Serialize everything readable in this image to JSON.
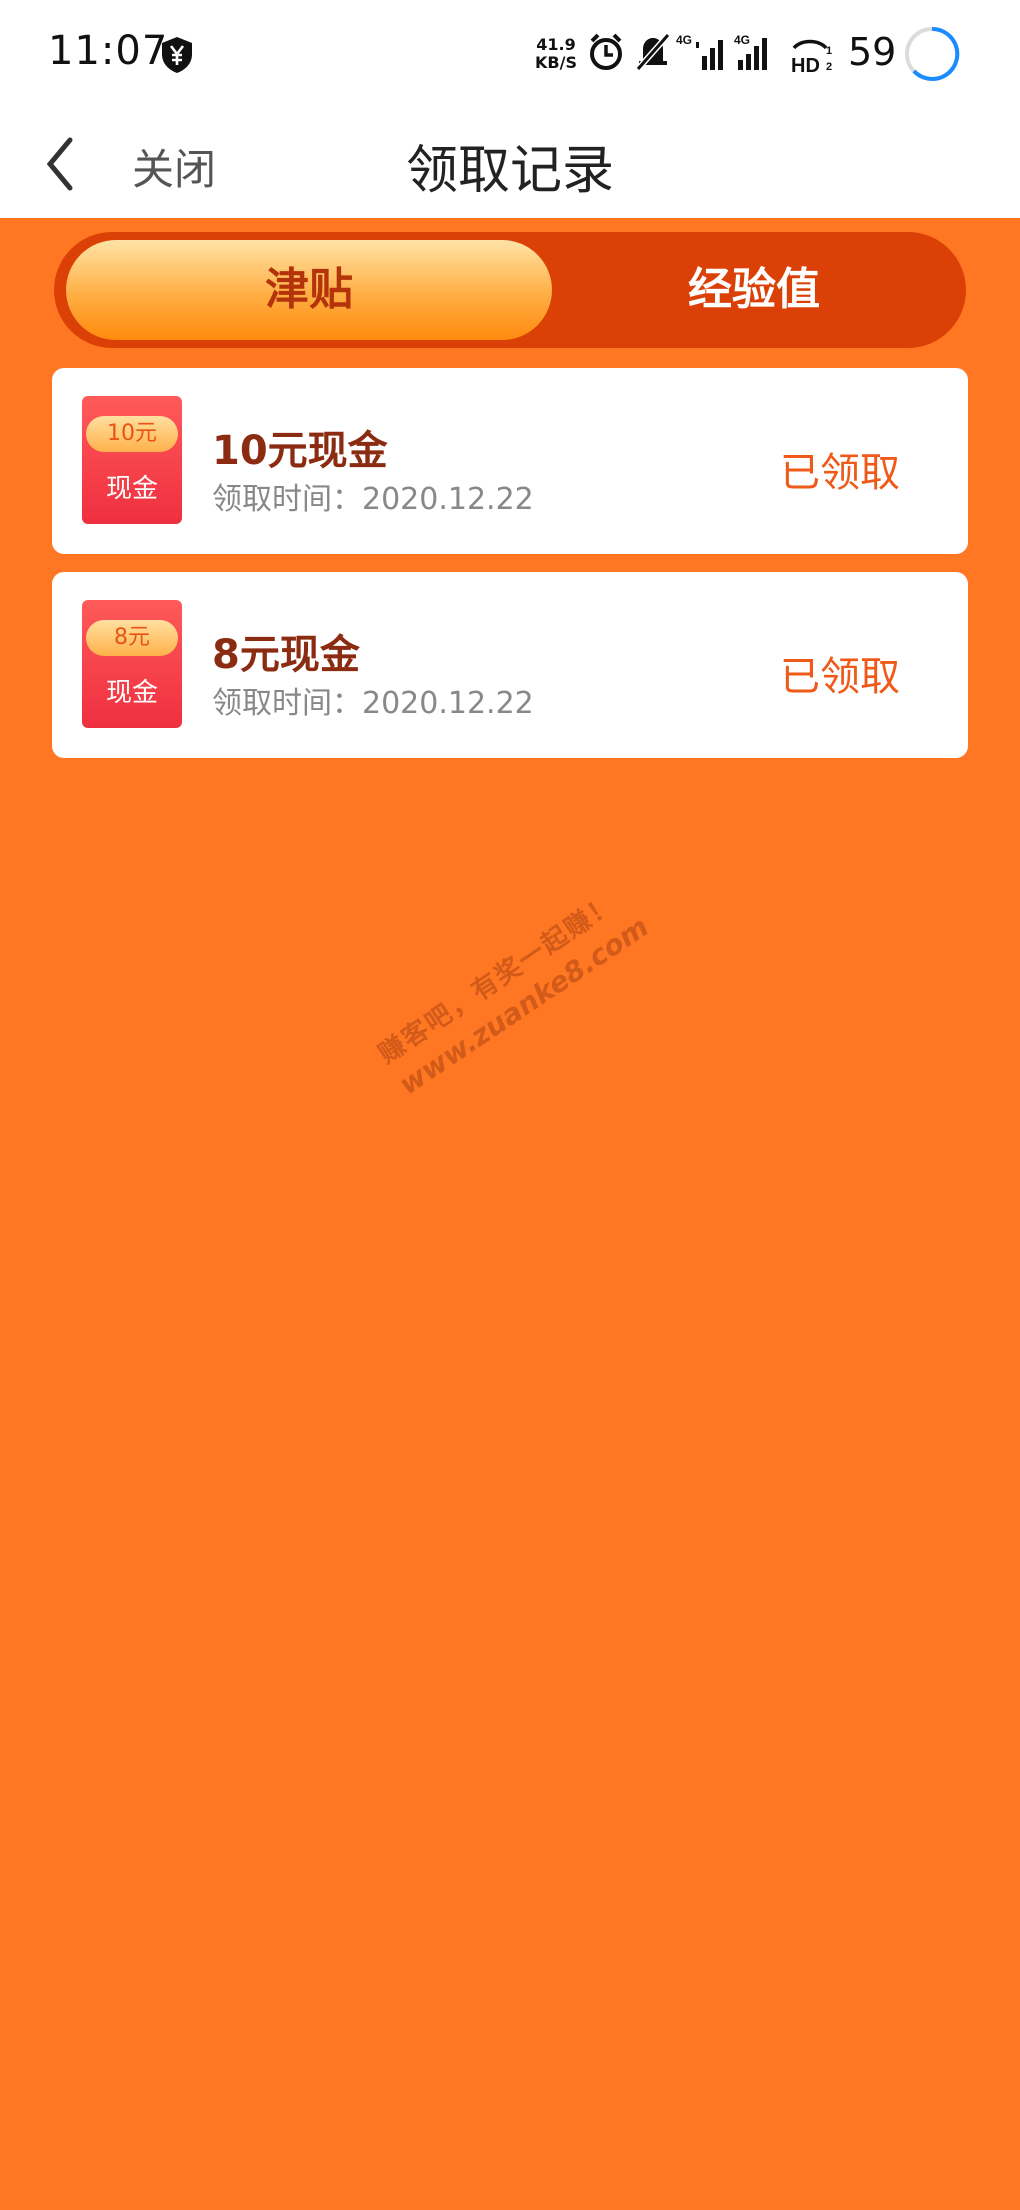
{
  "status_bar": {
    "time": "11:07",
    "net_speed_value": "41.9",
    "net_speed_unit": "KB/S",
    "battery": "59"
  },
  "nav": {
    "close_label": "关闭",
    "title": "领取记录"
  },
  "tabs": [
    {
      "label": "津贴",
      "active": true
    },
    {
      "label": "经验值",
      "active": false
    }
  ],
  "records": [
    {
      "coupon_amount": "10元",
      "coupon_kind": "现金",
      "title": "10元现金",
      "time": "领取时间：2020.12.22",
      "status": "已领取"
    },
    {
      "coupon_amount": "8元",
      "coupon_kind": "现金",
      "title": "8元现金",
      "time": "领取时间：2020.12.22",
      "status": "已领取"
    }
  ],
  "watermark": {
    "line1": "赚客吧，有奖一起赚！",
    "line2": "www.zuanke8.com"
  },
  "colors": {
    "background": "#ff7722",
    "tab_track": "#db4106",
    "accent": "#ef5a1a"
  }
}
